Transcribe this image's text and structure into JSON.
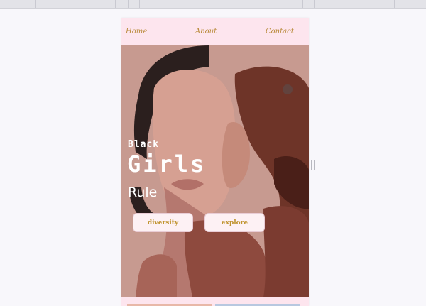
{
  "nav": {
    "home": "Home",
    "about": "About",
    "contact": "Contact"
  },
  "hero": {
    "line1": "Black",
    "line2": "Girls",
    "line3": "Rule"
  },
  "buttons": {
    "diversity": "diversity",
    "explore": "explore"
  },
  "colors": {
    "nav_bg": "#fde5ee",
    "nav_link": "#b98a3a",
    "hero_bg": "#c79a90",
    "button_text": "#c0942f",
    "button_bg": "#fdf1f4"
  },
  "icons": {
    "scroll_indicator": "scroll-dot-icon",
    "resize_handle": "resize-handle-icon"
  }
}
